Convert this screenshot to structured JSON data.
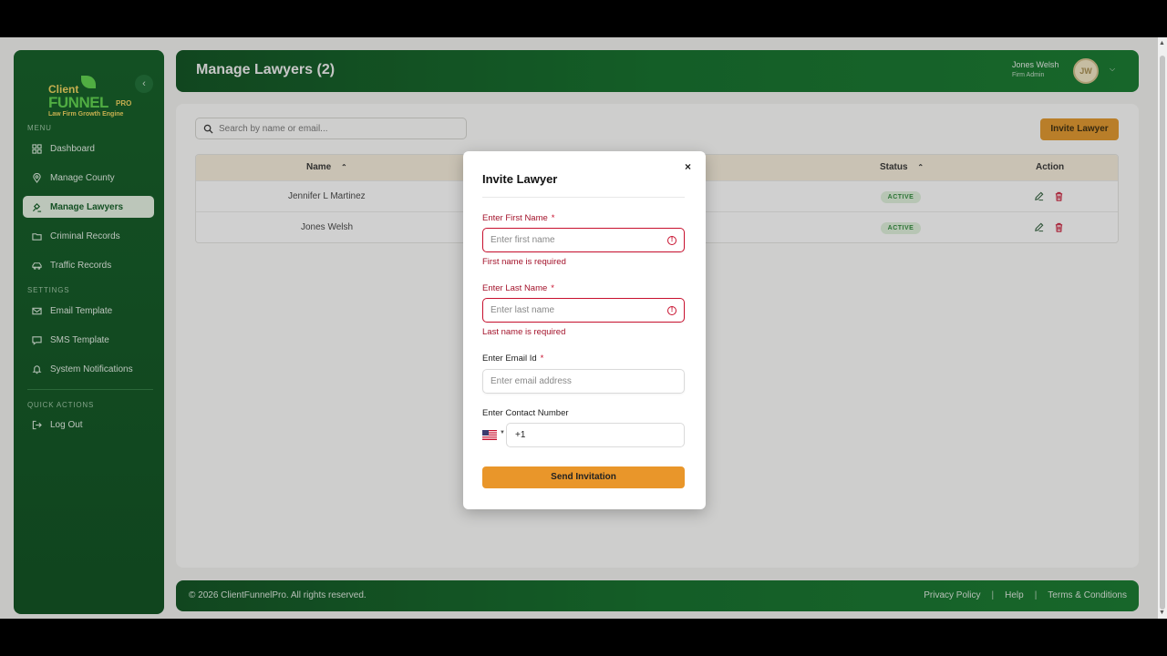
{
  "logo": {
    "line1": "Client",
    "line2": "FUNNEL",
    "pro": "PRO",
    "tagline": "Law Firm Growth Engine"
  },
  "sidebar": {
    "menu_label": "MENU",
    "items": [
      {
        "label": "Dashboard",
        "icon": "grid-icon"
      },
      {
        "label": "Manage County",
        "icon": "map-pin-icon"
      },
      {
        "label": "Manage Lawyers",
        "icon": "gavel-icon"
      },
      {
        "label": "Criminal Records",
        "icon": "folder-icon"
      },
      {
        "label": "Traffic Records",
        "icon": "car-icon"
      }
    ],
    "settings_label": "SETTINGS",
    "settings_items": [
      {
        "label": "Email Template",
        "icon": "mail-icon"
      },
      {
        "label": "SMS Template",
        "icon": "message-icon"
      },
      {
        "label": "System Notifications",
        "icon": "bell-icon"
      }
    ],
    "quick_label": "QUICK ACTIONS",
    "logout_label": "Log Out",
    "active_item": "Manage Lawyers"
  },
  "header": {
    "title": "Manage Lawyers (2)",
    "user_name": "Jones Welsh",
    "user_role": "Firm Admin",
    "avatar_initials": "JW"
  },
  "main": {
    "search_placeholder": "Search by name or email...",
    "invite_button": "Invite Lawyer",
    "columns": [
      "Name",
      "Status",
      "Action"
    ],
    "rows": [
      {
        "name": "Jennifer L Martinez",
        "status": "ACTIVE"
      },
      {
        "name": "Jones Welsh",
        "status": "ACTIVE"
      }
    ]
  },
  "footer": {
    "copyright": "© 2026 ClientFunnelPro. All rights reserved.",
    "links": [
      "Privacy Policy",
      "Help",
      "Terms & Conditions"
    ]
  },
  "modal": {
    "title": "Invite Lawyer",
    "close": "×",
    "first_name_label": "Enter First Name",
    "first_name_placeholder": "Enter first name",
    "first_name_error": "First name is required",
    "last_name_label": "Enter Last Name",
    "last_name_placeholder": "Enter last name",
    "last_name_error": "Last name is required",
    "email_label": "Enter Email Id",
    "email_placeholder": "Enter email address",
    "contact_label": "Enter Contact Number",
    "phone_value": "+1",
    "required_mark": "*",
    "submit": "Send Invitation"
  },
  "colors": {
    "brand_green": "#0f6d27",
    "accent_orange": "#e9962a",
    "error_red": "#c8102e"
  }
}
